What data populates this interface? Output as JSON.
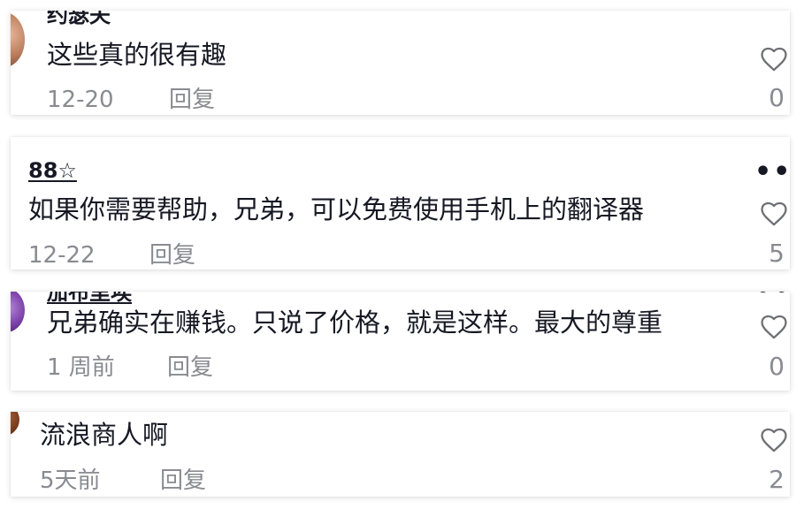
{
  "comments": [
    {
      "username": "约瑟夫",
      "text": "这些真的很有趣",
      "date": "12-20",
      "reply_label": "回复",
      "like_count": "0"
    },
    {
      "username": "88☆",
      "text": "如果你需要帮助，兄弟，可以免费使用手机上的翻译器",
      "date": "12-22",
      "reply_label": "回复",
      "like_count": "5",
      "more_label": "•••"
    },
    {
      "username": "加布里埃",
      "text": "兄弟确实在赚钱。只说了价格，就是这样。最大的尊重",
      "date": "1 周前",
      "reply_label": "回复",
      "like_count": "0"
    },
    {
      "text": "流浪商人啊",
      "date": "5天前",
      "reply_label": "回复",
      "like_count": "2"
    }
  ],
  "icons": {
    "like": "heart-outline-icon",
    "more": "more-horizontal-icon"
  },
  "colors": {
    "text_primary": "#161823",
    "text_secondary": "#8a8b91",
    "background": "#ffffff"
  }
}
